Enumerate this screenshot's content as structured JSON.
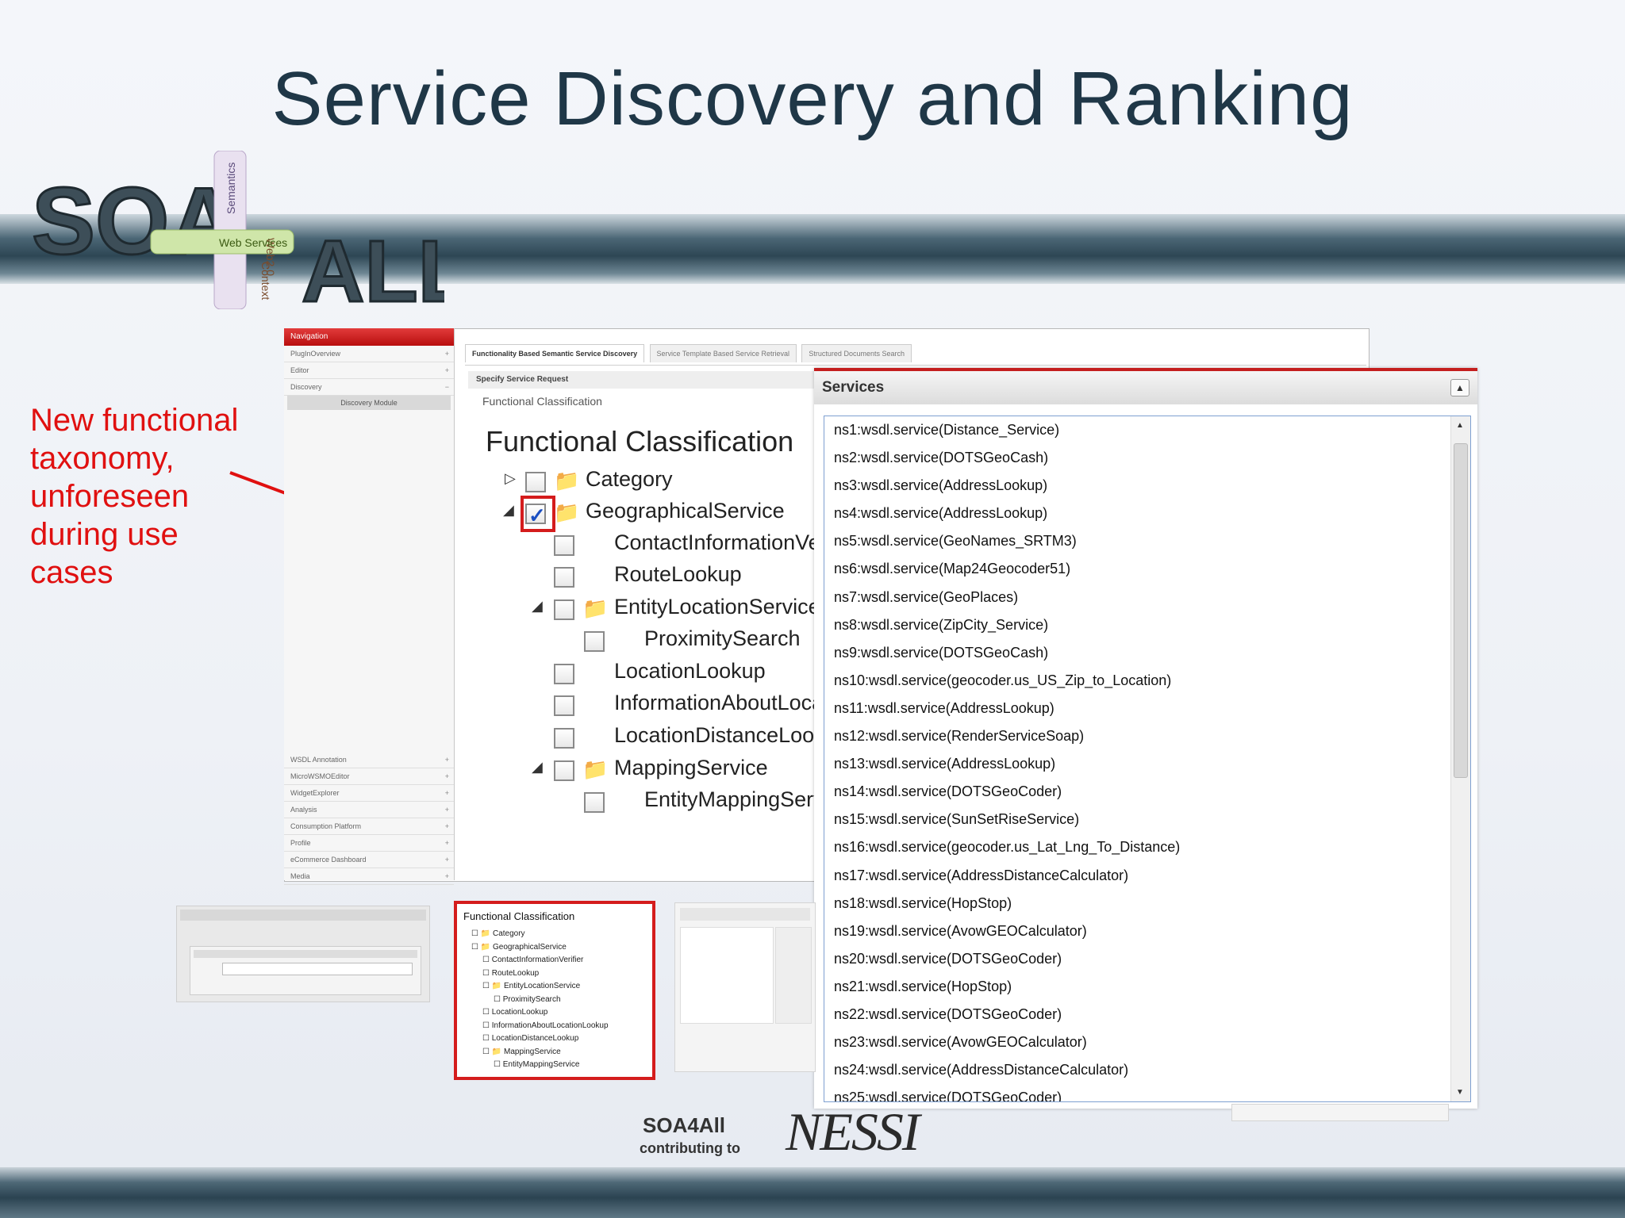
{
  "slide": {
    "title": "Service Discovery and Ranking",
    "annotation": [
      "New functional",
      "taxonomy,",
      "unforeseen",
      "during use",
      "cases"
    ]
  },
  "logo": {
    "vertical_labels": [
      "Semantics",
      "Web2.0",
      "Context"
    ],
    "web_services_label": "Web Services"
  },
  "colors": {
    "accent_red": "#d41c1c",
    "title": "#1f3747",
    "band": "#2d4654",
    "annotation": "#e01010"
  },
  "navigation": {
    "title": "Navigation",
    "items": [
      "PlugInOverview",
      "Editor",
      "Discovery"
    ],
    "sub_item": "Discovery Module",
    "lower_items": [
      "WSDL Annotation",
      "MicroWSMOEditor",
      "WidgetExplorer",
      "Analysis",
      "Consumption Platform",
      "Profile",
      "eCommerce Dashboard",
      "Media"
    ]
  },
  "tabs": [
    "Functionality Based Semantic Service Discovery",
    "Service Template Based Service Retrieval",
    "Structured Documents Search"
  ],
  "specify_header": "Specify Service Request",
  "fc_small_label": "Functional Classification",
  "fc_title": "Functional Classification",
  "tree": [
    {
      "label": "Category",
      "level": 0,
      "folder": true,
      "expander": "▷",
      "checked": false
    },
    {
      "label": "GeographicalService",
      "level": 0,
      "folder": true,
      "expander": "◢",
      "checked": true
    },
    {
      "label": "ContactInformationVe",
      "level": 1,
      "folder": false,
      "expander": "",
      "checked": false
    },
    {
      "label": "RouteLookup",
      "level": 1,
      "folder": false,
      "expander": "",
      "checked": false
    },
    {
      "label": "EntityLocationService",
      "level": 1,
      "folder": true,
      "expander": "◢",
      "checked": false
    },
    {
      "label": "ProximitySearch",
      "level": 2,
      "folder": false,
      "expander": "",
      "checked": false
    },
    {
      "label": "LocationLookup",
      "level": 1,
      "folder": false,
      "expander": "",
      "checked": false
    },
    {
      "label": "InformationAboutLoca",
      "level": 1,
      "folder": false,
      "expander": "",
      "checked": false
    },
    {
      "label": "LocationDistanceLoo",
      "level": 1,
      "folder": false,
      "expander": "",
      "checked": false
    },
    {
      "label": "MappingService",
      "level": 1,
      "folder": true,
      "expander": "◢",
      "checked": false
    },
    {
      "label": "EntityMappingServ",
      "level": 2,
      "folder": false,
      "expander": "",
      "checked": false
    }
  ],
  "services": {
    "title": "Services",
    "items": [
      "ns1:wsdl.service(Distance_Service)",
      "ns2:wsdl.service(DOTSGeoCash)",
      "ns3:wsdl.service(AddressLookup)",
      "ns4:wsdl.service(AddressLookup)",
      "ns5:wsdl.service(GeoNames_SRTM3)",
      "ns6:wsdl.service(Map24Geocoder51)",
      "ns7:wsdl.service(GeoPlaces)",
      "ns8:wsdl.service(ZipCity_Service)",
      "ns9:wsdl.service(DOTSGeoCash)",
      "ns10:wsdl.service(geocoder.us_US_Zip_to_Location)",
      "ns11:wsdl.service(AddressLookup)",
      "ns12:wsdl.service(RenderServiceSoap)",
      "ns13:wsdl.service(AddressLookup)",
      "ns14:wsdl.service(DOTSGeoCoder)",
      "ns15:wsdl.service(SunSetRiseService)",
      "ns16:wsdl.service(geocoder.us_Lat_Lng_To_Distance)",
      "ns17:wsdl.service(AddressDistanceCalculator)",
      "ns18:wsdl.service(HopStop)",
      "ns19:wsdl.service(AvowGEOCalculator)",
      "ns20:wsdl.service(DOTSGeoCoder)",
      "ns21:wsdl.service(HopStop)",
      "ns22:wsdl.service(DOTSGeoCoder)",
      "ns23:wsdl.service(AvowGEOCalculator)",
      "ns24:wsdl.service(AddressDistanceCalculator)",
      "ns25:wsdl.service(DOTSGeoCoder)"
    ]
  },
  "thumbnail_fc": {
    "title": "Functional Classification",
    "rows": [
      {
        "label": "Category",
        "level": 0,
        "folder": true
      },
      {
        "label": "GeographicalService",
        "level": 0,
        "folder": true
      },
      {
        "label": "ContactInformationVerifier",
        "level": 1,
        "folder": false
      },
      {
        "label": "RouteLookup",
        "level": 1,
        "folder": false
      },
      {
        "label": "EntityLocationService",
        "level": 1,
        "folder": true
      },
      {
        "label": "ProximitySearch",
        "level": 2,
        "folder": false
      },
      {
        "label": "LocationLookup",
        "level": 1,
        "folder": false
      },
      {
        "label": "InformationAboutLocationLookup",
        "level": 1,
        "folder": false
      },
      {
        "label": "LocationDistanceLookup",
        "level": 1,
        "folder": false
      },
      {
        "label": "MappingService",
        "level": 1,
        "folder": true
      },
      {
        "label": "EntityMappingService",
        "level": 2,
        "folder": false
      }
    ]
  },
  "footer": {
    "soa4all": "SOA4All",
    "contributing": "contributing to",
    "nessi": "NESSI"
  }
}
